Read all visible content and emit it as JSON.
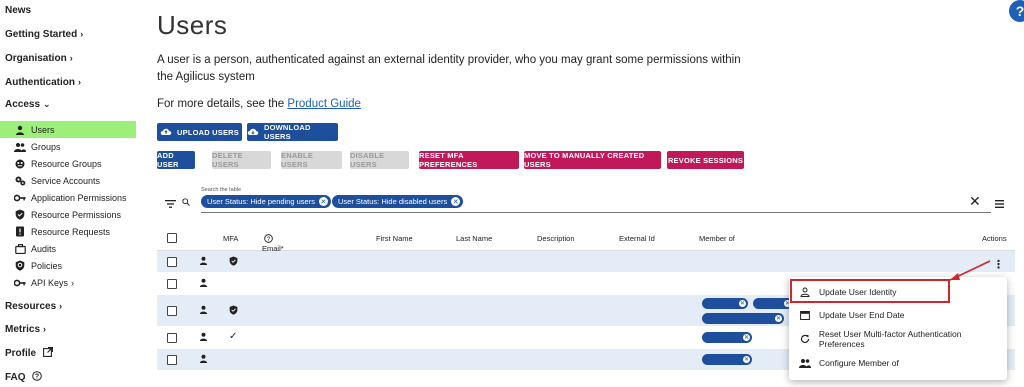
{
  "sidebar": {
    "top_items": [
      {
        "label": "News"
      },
      {
        "label": "Getting Started",
        "chevron": "›"
      },
      {
        "label": "Organisation",
        "chevron": "›"
      },
      {
        "label": "Authentication",
        "chevron": "›"
      },
      {
        "label": "Access",
        "chevron": "⌄"
      }
    ],
    "access_items": [
      {
        "label": "Users",
        "icon": "person-icon",
        "active": true
      },
      {
        "label": "Groups",
        "icon": "group-icon"
      },
      {
        "label": "Resource Groups",
        "icon": "resource-groups-icon"
      },
      {
        "label": "Service Accounts",
        "icon": "service-accounts-icon"
      },
      {
        "label": "Application Permissions",
        "icon": "key-icon"
      },
      {
        "label": "Resource Permissions",
        "icon": "shield-icon"
      },
      {
        "label": "Resource Requests",
        "icon": "request-icon"
      },
      {
        "label": "Audits",
        "icon": "briefcase-icon"
      },
      {
        "label": "Policies",
        "icon": "policy-icon"
      },
      {
        "label": "API Keys",
        "icon": "key-icon",
        "chevron": "›"
      }
    ],
    "bottom_items": [
      {
        "label": "Resources",
        "chevron": "›"
      },
      {
        "label": "Metrics",
        "chevron": "›"
      },
      {
        "label": "Profile",
        "icon": "external-link-icon"
      },
      {
        "label": "FAQ",
        "icon": "help-circle-icon"
      }
    ]
  },
  "main": {
    "title": "Users",
    "description": "A user is a person, authenticated against an external identity provider, who you may grant some permissions within the Agilicus system",
    "more_prefix": "For more details, see the",
    "more_link": "Product Guide",
    "buttons_row1": [
      {
        "label": "UPLOAD USERS",
        "icon": "cloud-upload-icon"
      },
      {
        "label": "DOWNLOAD USERS",
        "icon": "cloud-download-icon"
      }
    ],
    "buttons_row2": [
      {
        "label": "ADD USER",
        "style": "blue"
      },
      {
        "label": "DELETE USERS",
        "style": "gray"
      },
      {
        "label": "ENABLE USERS",
        "style": "gray"
      },
      {
        "label": "DISABLE USERS",
        "style": "gray"
      },
      {
        "label": "RESET MFA PREFERENCES",
        "style": "red"
      },
      {
        "label": "MOVE TO MANUALLY CREATED USERS",
        "style": "red"
      },
      {
        "label": "REVOKE SESSIONS",
        "style": "red"
      }
    ],
    "search": {
      "label": "Search the table",
      "chips": [
        "User Status: Hide pending users",
        "User Status: Hide disabled users"
      ]
    },
    "table": {
      "headers": {
        "mfa": "MFA",
        "email": "Email*",
        "first_name": "First Name",
        "last_name": "Last Name",
        "description": "Description",
        "external_id": "External Id",
        "member_of": "Member of",
        "actions": "Actions"
      }
    },
    "context_menu": [
      {
        "label": "Update User Identity",
        "icon": "person-outline-icon"
      },
      {
        "label": "Update User End Date",
        "icon": "calendar-icon"
      },
      {
        "label": "Reset User Multi-factor Authentication Preferences",
        "icon": "refresh-icon"
      },
      {
        "label": "Configure Member of",
        "icon": "group-icon"
      }
    ]
  },
  "colors": {
    "primary": "#1e4f9c",
    "danger": "#c1185a",
    "active_nav": "#9cf07a",
    "highlight": "#d0262d",
    "row_alt": "#e4ecf7"
  }
}
